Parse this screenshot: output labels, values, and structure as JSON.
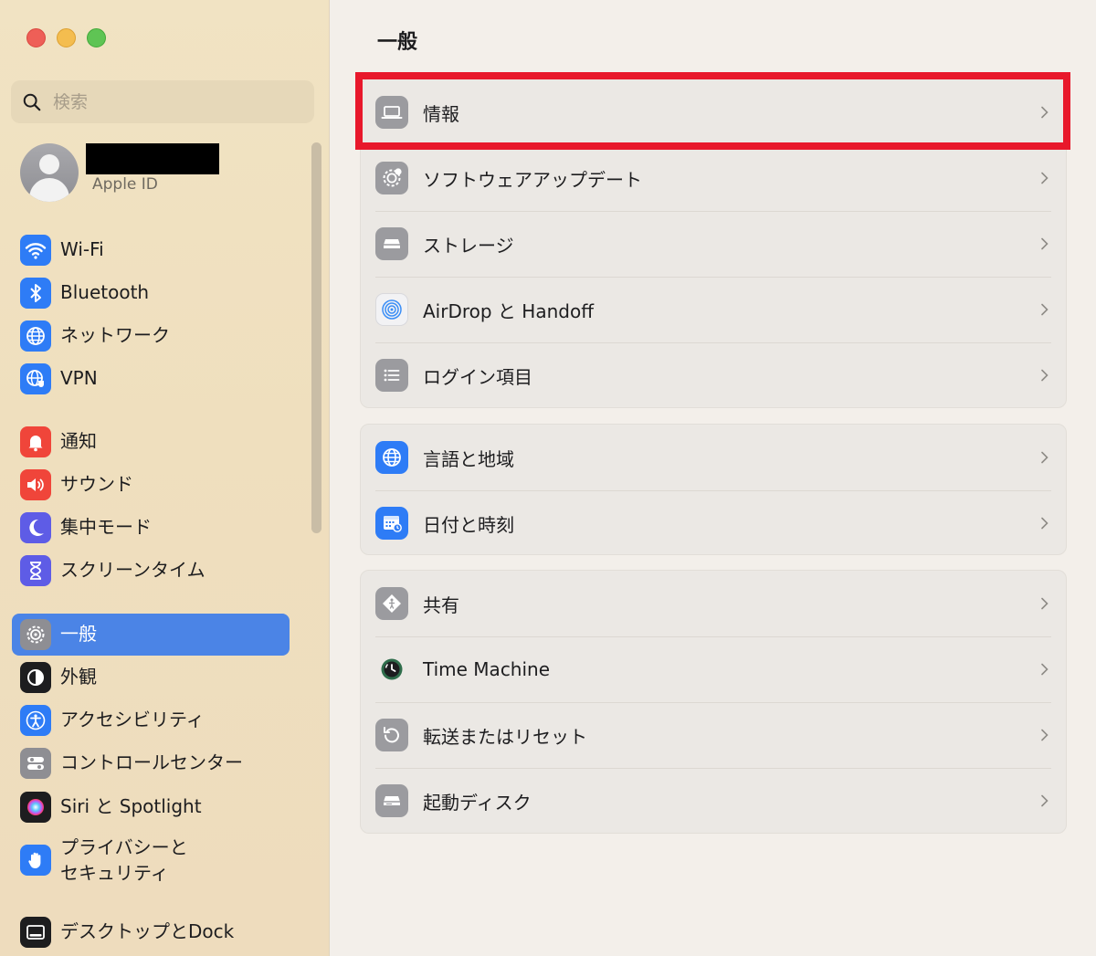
{
  "window": {
    "traffic_lights": [
      "close",
      "minimize",
      "zoom"
    ]
  },
  "sidebar": {
    "search_placeholder": "検索",
    "account": {
      "label": "Apple ID"
    },
    "items": [
      {
        "label": "Wi-Fi",
        "icon": "wifi-icon",
        "color": "#2e7cf6"
      },
      {
        "label": "Bluetooth",
        "icon": "bluetooth-icon",
        "color": "#2e7cf6"
      },
      {
        "label": "ネットワーク",
        "icon": "globe-icon",
        "color": "#2e7cf6"
      },
      {
        "label": "VPN",
        "icon": "vpn-globe-icon",
        "color": "#2e7cf6"
      },
      {
        "label": "通知",
        "icon": "bell-icon",
        "color": "#f0453a"
      },
      {
        "label": "サウンド",
        "icon": "speaker-icon",
        "color": "#f0453a"
      },
      {
        "label": "集中モード",
        "icon": "moon-icon",
        "color": "#5e5ce6"
      },
      {
        "label": "スクリーンタイム",
        "icon": "hourglass-icon",
        "color": "#5e5ce6"
      },
      {
        "label": "一般",
        "icon": "gear-icon",
        "color": "#8e8e93",
        "selected": true
      },
      {
        "label": "外観",
        "icon": "appearance-icon",
        "color": "#1d1d1f"
      },
      {
        "label": "アクセシビリティ",
        "icon": "accessibility-icon",
        "color": "#2e7cf6"
      },
      {
        "label": "コントロールセンター",
        "icon": "toggles-icon",
        "color": "#8e8e93"
      },
      {
        "label": "Siri と Spotlight",
        "icon": "siri-icon",
        "color": "#1d1d1f"
      },
      {
        "label": "プライバシーと\nセキュリティ",
        "icon": "hand-icon",
        "color": "#2e7cf6"
      },
      {
        "label": "デスクトップとDock",
        "icon": "dock-icon",
        "color": "#1d1d1f"
      }
    ]
  },
  "main": {
    "title": "一般",
    "groups": [
      {
        "rows": [
          {
            "label": "情報",
            "icon": "laptop-icon"
          },
          {
            "label": "ソフトウェアアップデート",
            "icon": "software-update-icon"
          },
          {
            "label": "ストレージ",
            "icon": "storage-icon"
          },
          {
            "label": "AirDrop と Handoff",
            "icon": "airdrop-icon"
          },
          {
            "label": "ログイン項目",
            "icon": "list-icon"
          }
        ]
      },
      {
        "rows": [
          {
            "label": "言語と地域",
            "icon": "globe-icon"
          },
          {
            "label": "日付と時刻",
            "icon": "calendar-clock-icon"
          }
        ]
      },
      {
        "rows": [
          {
            "label": "共有",
            "icon": "sharing-icon"
          },
          {
            "label": "Time Machine",
            "icon": "time-machine-icon"
          },
          {
            "label": "転送またはリセット",
            "icon": "reset-icon"
          },
          {
            "label": "起動ディスク",
            "icon": "disk-icon"
          }
        ]
      }
    ],
    "highlight_color": "#e8182b"
  }
}
